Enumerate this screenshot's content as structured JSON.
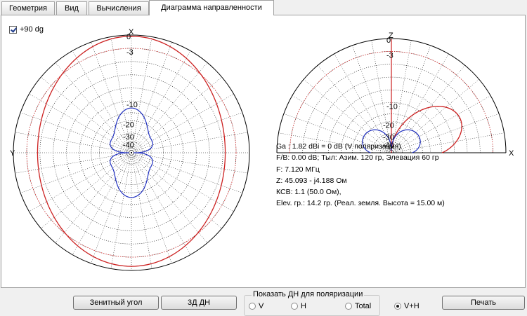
{
  "tabs": [
    {
      "label": "Геометрия"
    },
    {
      "label": "Вид"
    },
    {
      "label": "Вычисления"
    },
    {
      "label": "Диаграмма направленности",
      "active": true
    }
  ],
  "checkbox": {
    "label": "+90 dg",
    "checked": true
  },
  "left_plot": {
    "axis_top": "X",
    "axis_left": "Y",
    "ring_labels": [
      "0",
      "-3",
      "-10",
      "-20",
      "-30",
      "-40"
    ]
  },
  "right_plot": {
    "axis_top": "Z",
    "axis_right": "X",
    "ring_labels": [
      "0",
      "-3",
      "-10",
      "-20",
      "-30",
      "-40"
    ]
  },
  "info": {
    "lines": [
      "Ga : 1.82 dBi = 0 dB  (V поляризация)",
      "F/B: 0.00 dB; Тыл: Азим. 120 гр, Элевация 60 гр",
      "F: 7.120 МГц",
      "Z: 45.093 - j4.188 Ом",
      "КСВ: 1.1 (50.0 Ом),",
      "Elev. гр.: 14.2 гр. (Реал. земля. Высота = 15.00 м)"
    ]
  },
  "buttons": {
    "zenith": "Зенитный угол",
    "dn3d": "3Д   ДН",
    "print": "Печать"
  },
  "polarization": {
    "legend": "Показать ДН для поляризации",
    "options": [
      {
        "label": "V",
        "selected": false
      },
      {
        "label": "H",
        "selected": false
      },
      {
        "label": "Total",
        "selected": false
      },
      {
        "label": "V+H",
        "selected": true
      }
    ]
  },
  "colors": {
    "v_pattern": "#cc2020",
    "h_pattern": "#2030c0",
    "grid": "#000000",
    "ref_circle": "#dd3333"
  }
}
